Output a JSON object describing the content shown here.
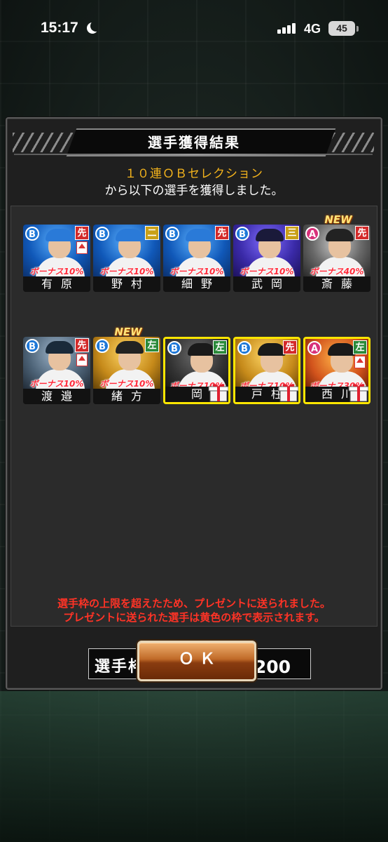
{
  "status_bar": {
    "time": "15:17",
    "network": "4G",
    "battery": "45"
  },
  "dialog": {
    "title": "選手獲得結果",
    "result_line1": "１０連ＯＢセレクション",
    "result_line2": "から以下の選手を獲得しました。",
    "players": [
      {
        "name": "有原",
        "grade": "B",
        "position": "先",
        "bonus": "ボーナス10%",
        "new": false,
        "gift": false,
        "up": true,
        "theme": "blue",
        "pos_color": "#d32a2a",
        "cap_color": "#2a7ad8"
      },
      {
        "name": "野村",
        "grade": "B",
        "position": "二",
        "bonus": "ボーナス10%",
        "new": false,
        "gift": false,
        "up": false,
        "theme": "blue",
        "pos_color": "#c9a018",
        "cap_color": "#2a7ad8"
      },
      {
        "name": "細野",
        "grade": "B",
        "position": "先",
        "bonus": "ボーナス10%",
        "new": false,
        "gift": false,
        "up": false,
        "theme": "blue",
        "pos_color": "#d32a2a",
        "cap_color": "#2a7ad8"
      },
      {
        "name": "武岡",
        "grade": "B",
        "position": "三",
        "bonus": "ボーナス10%",
        "new": false,
        "gift": false,
        "up": false,
        "theme": "purple",
        "pos_color": "#c9a018",
        "cap_color": "#1a1a3a"
      },
      {
        "name": "斎藤",
        "grade": "A",
        "position": "先",
        "bonus": "ボーナス40%",
        "new": true,
        "gift": false,
        "up": false,
        "theme": "storm",
        "pos_color": "#d32a2a",
        "cap_color": "#222222"
      },
      {
        "name": "渡邉",
        "grade": "B",
        "position": "先",
        "bonus": "ボーナス10%",
        "new": false,
        "gift": false,
        "up": true,
        "theme": "steel",
        "pos_color": "#d32a2a",
        "cap_color": "#1a2a3a"
      },
      {
        "name": "緒方",
        "grade": "B",
        "position": "左",
        "bonus": "ボーナス10%",
        "new": true,
        "gift": false,
        "up": false,
        "theme": "gold",
        "pos_color": "#2a8a3a",
        "cap_color": "#222222"
      },
      {
        "name": "岡",
        "grade": "B",
        "position": "左",
        "bonus": "ボーナス10%",
        "new": false,
        "gift": true,
        "up": false,
        "theme": "dark",
        "pos_color": "#2a8a3a",
        "cap_color": "#1a1a1a"
      },
      {
        "name": "戸柱",
        "grade": "B",
        "position": "先",
        "bonus": "ボーナス10%",
        "new": false,
        "gift": true,
        "up": false,
        "theme": "gold",
        "pos_color": "#d32a2a",
        "cap_color": "#1a1a1a"
      },
      {
        "name": "西川",
        "grade": "A",
        "position": "左",
        "bonus": "ボーナス30%",
        "new": false,
        "gift": true,
        "up": true,
        "theme": "fire",
        "pos_color": "#2a8a3a",
        "cap_color": "#1a1a1a"
      }
    ],
    "new_badge": "NEW",
    "slot_label": "選手枠：",
    "slot_current": "200",
    "slot_separator": "／",
    "slot_max": "200",
    "notice_line1": "選手枠の上限を超えたため、プレゼントに送られました。",
    "notice_line2": "プレゼントに送られた選手は黄色の枠で表示されます。",
    "ok_label": "ＯＫ"
  }
}
